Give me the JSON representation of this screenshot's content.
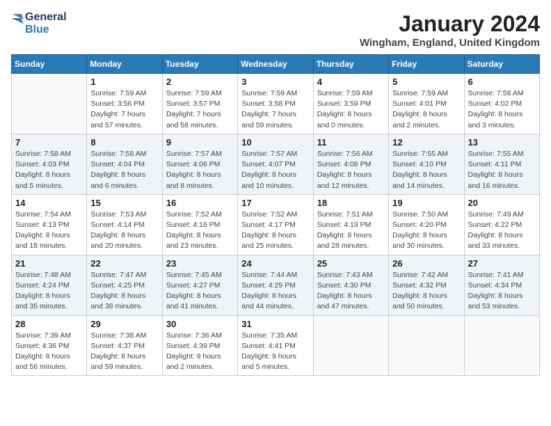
{
  "header": {
    "logo_line1": "General",
    "logo_line2": "Blue",
    "month": "January 2024",
    "location": "Wingham, England, United Kingdom"
  },
  "weekdays": [
    "Sunday",
    "Monday",
    "Tuesday",
    "Wednesday",
    "Thursday",
    "Friday",
    "Saturday"
  ],
  "weeks": [
    [
      {
        "day": "",
        "info": ""
      },
      {
        "day": "1",
        "info": "Sunrise: 7:59 AM\nSunset: 3:56 PM\nDaylight: 7 hours\nand 57 minutes."
      },
      {
        "day": "2",
        "info": "Sunrise: 7:59 AM\nSunset: 3:57 PM\nDaylight: 7 hours\nand 58 minutes."
      },
      {
        "day": "3",
        "info": "Sunrise: 7:59 AM\nSunset: 3:58 PM\nDaylight: 7 hours\nand 59 minutes."
      },
      {
        "day": "4",
        "info": "Sunrise: 7:59 AM\nSunset: 3:59 PM\nDaylight: 8 hours\nand 0 minutes."
      },
      {
        "day": "5",
        "info": "Sunrise: 7:59 AM\nSunset: 4:01 PM\nDaylight: 8 hours\nand 2 minutes."
      },
      {
        "day": "6",
        "info": "Sunrise: 7:58 AM\nSunset: 4:02 PM\nDaylight: 8 hours\nand 3 minutes."
      }
    ],
    [
      {
        "day": "7",
        "info": "Sunrise: 7:58 AM\nSunset: 4:03 PM\nDaylight: 8 hours\nand 5 minutes."
      },
      {
        "day": "8",
        "info": "Sunrise: 7:58 AM\nSunset: 4:04 PM\nDaylight: 8 hours\nand 6 minutes."
      },
      {
        "day": "9",
        "info": "Sunrise: 7:57 AM\nSunset: 4:06 PM\nDaylight: 8 hours\nand 8 minutes."
      },
      {
        "day": "10",
        "info": "Sunrise: 7:57 AM\nSunset: 4:07 PM\nDaylight: 8 hours\nand 10 minutes."
      },
      {
        "day": "11",
        "info": "Sunrise: 7:56 AM\nSunset: 4:08 PM\nDaylight: 8 hours\nand 12 minutes."
      },
      {
        "day": "12",
        "info": "Sunrise: 7:55 AM\nSunset: 4:10 PM\nDaylight: 8 hours\nand 14 minutes."
      },
      {
        "day": "13",
        "info": "Sunrise: 7:55 AM\nSunset: 4:11 PM\nDaylight: 8 hours\nand 16 minutes."
      }
    ],
    [
      {
        "day": "14",
        "info": "Sunrise: 7:54 AM\nSunset: 4:13 PM\nDaylight: 8 hours\nand 18 minutes."
      },
      {
        "day": "15",
        "info": "Sunrise: 7:53 AM\nSunset: 4:14 PM\nDaylight: 8 hours\nand 20 minutes."
      },
      {
        "day": "16",
        "info": "Sunrise: 7:52 AM\nSunset: 4:16 PM\nDaylight: 8 hours\nand 23 minutes."
      },
      {
        "day": "17",
        "info": "Sunrise: 7:52 AM\nSunset: 4:17 PM\nDaylight: 8 hours\nand 25 minutes."
      },
      {
        "day": "18",
        "info": "Sunrise: 7:51 AM\nSunset: 4:19 PM\nDaylight: 8 hours\nand 28 minutes."
      },
      {
        "day": "19",
        "info": "Sunrise: 7:50 AM\nSunset: 4:20 PM\nDaylight: 8 hours\nand 30 minutes."
      },
      {
        "day": "20",
        "info": "Sunrise: 7:49 AM\nSunset: 4:22 PM\nDaylight: 8 hours\nand 33 minutes."
      }
    ],
    [
      {
        "day": "21",
        "info": "Sunrise: 7:48 AM\nSunset: 4:24 PM\nDaylight: 8 hours\nand 35 minutes."
      },
      {
        "day": "22",
        "info": "Sunrise: 7:47 AM\nSunset: 4:25 PM\nDaylight: 8 hours\nand 38 minutes."
      },
      {
        "day": "23",
        "info": "Sunrise: 7:45 AM\nSunset: 4:27 PM\nDaylight: 8 hours\nand 41 minutes."
      },
      {
        "day": "24",
        "info": "Sunrise: 7:44 AM\nSunset: 4:29 PM\nDaylight: 8 hours\nand 44 minutes."
      },
      {
        "day": "25",
        "info": "Sunrise: 7:43 AM\nSunset: 4:30 PM\nDaylight: 8 hours\nand 47 minutes."
      },
      {
        "day": "26",
        "info": "Sunrise: 7:42 AM\nSunset: 4:32 PM\nDaylight: 8 hours\nand 50 minutes."
      },
      {
        "day": "27",
        "info": "Sunrise: 7:41 AM\nSunset: 4:34 PM\nDaylight: 8 hours\nand 53 minutes."
      }
    ],
    [
      {
        "day": "28",
        "info": "Sunrise: 7:39 AM\nSunset: 4:36 PM\nDaylight: 8 hours\nand 56 minutes."
      },
      {
        "day": "29",
        "info": "Sunrise: 7:38 AM\nSunset: 4:37 PM\nDaylight: 8 hours\nand 59 minutes."
      },
      {
        "day": "30",
        "info": "Sunrise: 7:36 AM\nSunset: 4:39 PM\nDaylight: 9 hours\nand 2 minutes."
      },
      {
        "day": "31",
        "info": "Sunrise: 7:35 AM\nSunset: 4:41 PM\nDaylight: 9 hours\nand 5 minutes."
      },
      {
        "day": "",
        "info": ""
      },
      {
        "day": "",
        "info": ""
      },
      {
        "day": "",
        "info": ""
      }
    ]
  ]
}
